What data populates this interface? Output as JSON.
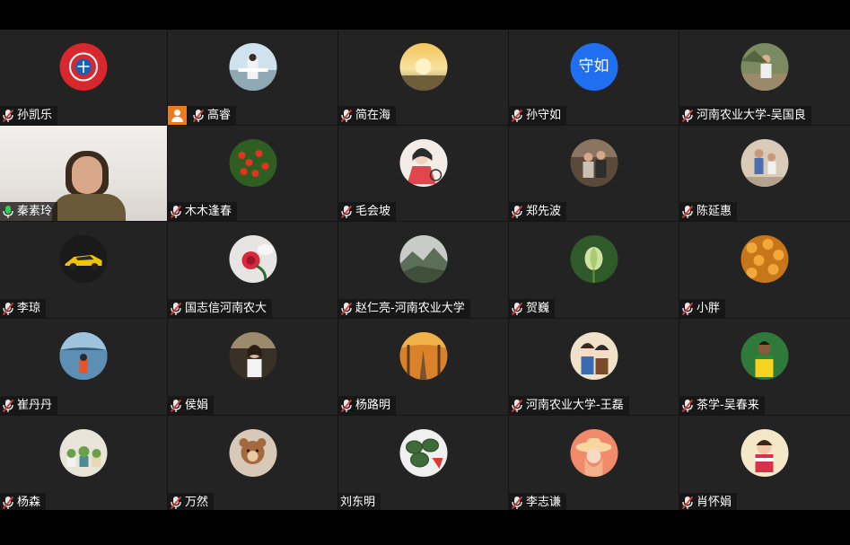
{
  "colors": {
    "tile_bg": "#232323",
    "active_border": "#2fd05a",
    "text_avatar_bg": "#1f6ff0",
    "camera_badge": "#ef7a1a",
    "mic_muted": "#d23a3a",
    "mic_active": "#2fd05a"
  },
  "participants": [
    {
      "name": "孙凯乐",
      "avatar": "red-club-logo",
      "mic": "muted"
    },
    {
      "name": "高睿",
      "avatar": "outdoor-photo",
      "mic": "muted",
      "camera_badge": true
    },
    {
      "name": "简在海",
      "avatar": "sunset-photo",
      "mic": "muted"
    },
    {
      "name": "孙守如",
      "avatar_text": "守如",
      "mic": "muted"
    },
    {
      "name": "河南农业大学-吴国良",
      "avatar": "person-outdoor-photo",
      "mic": "muted"
    },
    {
      "name": "秦素玲",
      "video": true,
      "mic": "active"
    },
    {
      "name": "木木逢春",
      "avatar": "tomato-plant-photo",
      "mic": "muted"
    },
    {
      "name": "毛会坡",
      "avatar": "cartoon-girl-illustration",
      "mic": "muted"
    },
    {
      "name": "郑先波",
      "avatar": "family-photo",
      "mic": "muted"
    },
    {
      "name": "陈延惠",
      "avatar": "children-photo",
      "mic": "muted"
    },
    {
      "name": "李琼",
      "avatar": "yellow-sports-car",
      "mic": "muted"
    },
    {
      "name": "国志信河南农大",
      "avatar": "red-rose",
      "mic": "muted"
    },
    {
      "name": "赵仁亮-河南农业大学",
      "avatar": "mountain-landscape",
      "mic": "muted"
    },
    {
      "name": "贺巍",
      "avatar": "green-bud",
      "mic": "muted"
    },
    {
      "name": "小胖",
      "avatar": "orange-flowers",
      "mic": "muted"
    },
    {
      "name": "崔丹丹",
      "avatar": "lake-person-photo",
      "mic": "muted"
    },
    {
      "name": "侯娟",
      "avatar": "woman-photo",
      "mic": "muted"
    },
    {
      "name": "杨路明",
      "avatar": "autumn-road",
      "mic": "muted"
    },
    {
      "name": "河南农业大学-王磊",
      "avatar": "anime-characters",
      "mic": "muted"
    },
    {
      "name": "茶学-吴春来",
      "avatar": "soccer-player",
      "mic": "muted"
    },
    {
      "name": "杨森",
      "avatar": "potted-succulents",
      "mic": "muted"
    },
    {
      "name": "万然",
      "avatar": "cartoon-bear",
      "mic": "muted"
    },
    {
      "name": "刘东明",
      "avatar": "watermelon-photo",
      "mic": "none"
    },
    {
      "name": "李志谦",
      "avatar": "girl-hat-illustration",
      "mic": "muted"
    },
    {
      "name": "肖怀娟",
      "avatar": "child-photo",
      "mic": "muted"
    }
  ]
}
